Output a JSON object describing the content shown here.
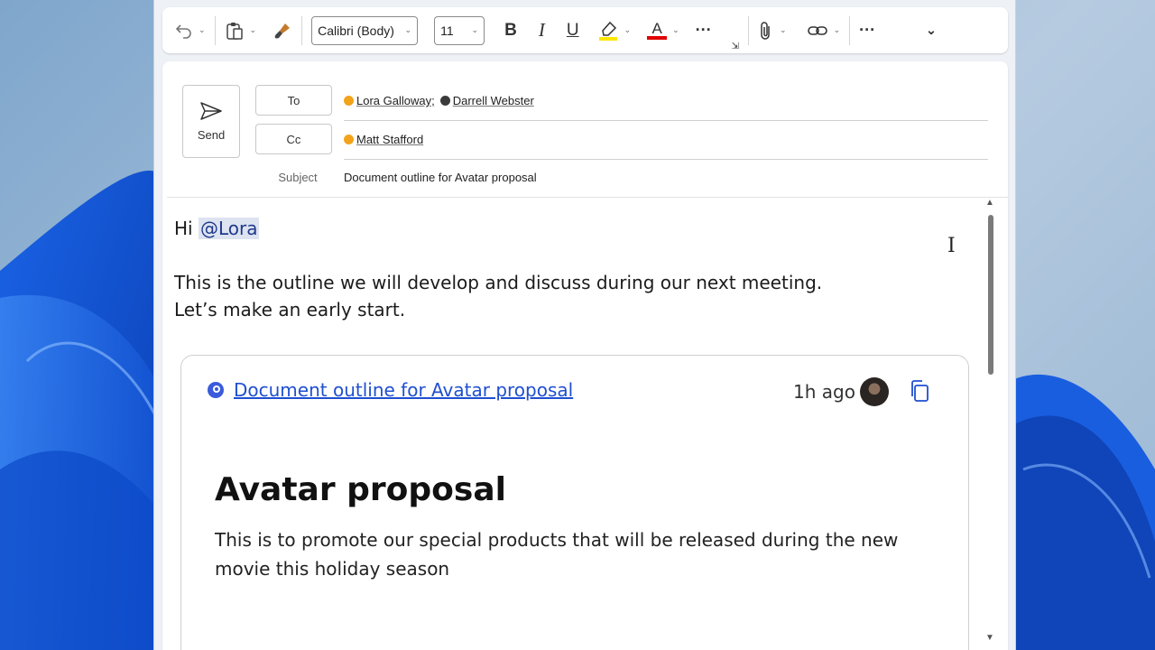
{
  "ribbon": {
    "font_name": "Calibri (Body)",
    "font_size": "11",
    "bold_label": "B",
    "italic_label": "I",
    "underline_label": "U",
    "font_color_label": "A",
    "more_label": "···",
    "overflow_label": "···"
  },
  "header": {
    "send_label": "Send",
    "to_label": "To",
    "cc_label": "Cc",
    "subject_label": "Subject",
    "to_recipients": [
      "Lora Galloway;",
      "Darrell Webster"
    ],
    "cc_recipients": [
      "Matt Stafford"
    ],
    "subject": "Document outline for Avatar proposal"
  },
  "body": {
    "greeting": "Hi",
    "mention": "@Lora",
    "line1": "This is the outline we will develop and discuss during our next meeting.",
    "line2": "Let’s make an early start."
  },
  "card": {
    "link_text": "Document outline for Avatar proposal",
    "time": "1h ago",
    "doc_title": "Avatar proposal",
    "doc_text": "This is to promote our special products that will be released during the new movie this holiday season"
  },
  "colors": {
    "accent_link": "#1f4fd1",
    "highlight_bar": "#ffe600",
    "font_color_bar": "#e00000"
  }
}
